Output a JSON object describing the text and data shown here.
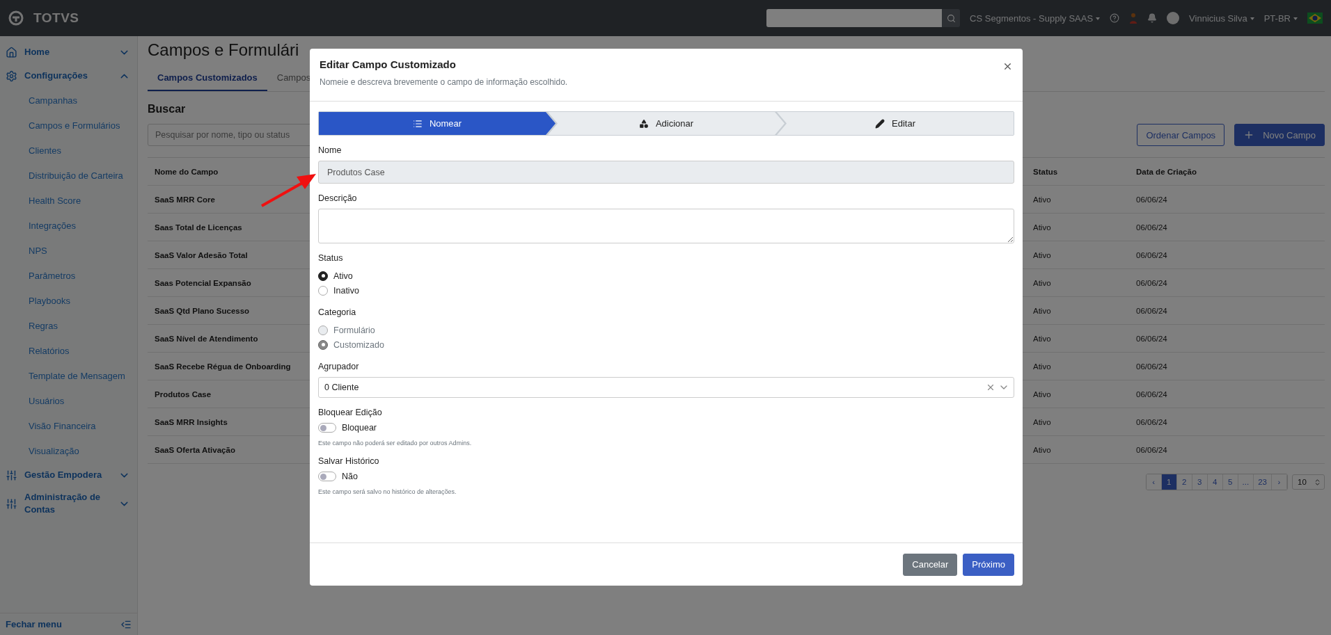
{
  "topbar": {
    "logo": "TOTVS",
    "workspace": "CS Segmentos - Supply SAAS",
    "user": "Vinnicius Silva",
    "language": "PT-BR"
  },
  "sidebar": {
    "items": [
      {
        "label": "Home",
        "kind": "home",
        "expanded": false
      },
      {
        "label": "Configurações",
        "kind": "gear",
        "expanded": true,
        "children": [
          {
            "label": "Campanhas"
          },
          {
            "label": "Campos e Formulários"
          },
          {
            "label": "Clientes"
          },
          {
            "label": "Distribuição de Carteira"
          },
          {
            "label": "Health Score"
          },
          {
            "label": "Integrações"
          },
          {
            "label": "NPS"
          },
          {
            "label": "Parâmetros"
          },
          {
            "label": "Playbooks"
          },
          {
            "label": "Regras"
          },
          {
            "label": "Relatórios"
          },
          {
            "label": "Template de Mensagem"
          },
          {
            "label": "Usuários"
          },
          {
            "label": "Visão Financeira"
          },
          {
            "label": "Visualização"
          }
        ]
      },
      {
        "label": "Gestão Empodera",
        "kind": "sliders",
        "expanded": false
      },
      {
        "label": "Administração de Contas",
        "kind": "sliders",
        "expanded": false
      }
    ],
    "footer": "Fechar menu"
  },
  "page": {
    "title": "Campos e Formulári",
    "tabs": [
      {
        "label": "Campos Customizados",
        "selected": true
      },
      {
        "label": "Campos",
        "selected": false
      }
    ],
    "search_heading": "Buscar",
    "search": {
      "placeholder": "Pesquisar por nome, tipo ou status"
    },
    "buttons": [
      {
        "label": "Ordenar Campos",
        "kind": "outline"
      },
      {
        "label": "Novo Campo",
        "kind": "primary"
      }
    ],
    "table": {
      "columns": [
        "Nome do Campo",
        "Status",
        "Data de Criação"
      ],
      "rows": [
        {
          "name": "SaaS MRR Core",
          "status": "Ativo",
          "created": "06/06/24"
        },
        {
          "name": "Saas Total de Licenças",
          "status": "Ativo",
          "created": "06/06/24"
        },
        {
          "name": "SaaS Valor Adesão Total",
          "status": "Ativo",
          "created": "06/06/24"
        },
        {
          "name": "Saas Potencial Expansão",
          "status": "Ativo",
          "created": "06/06/24"
        },
        {
          "name": "SaaS Qtd Plano Sucesso",
          "status": "Ativo",
          "created": "06/06/24"
        },
        {
          "name": "SaaS Nível de Atendimento",
          "status": "Ativo",
          "created": "06/06/24"
        },
        {
          "name": "SaaS Recebe Régua de Onboarding",
          "status": "Ativo",
          "created": "06/06/24"
        },
        {
          "name": "Produtos Case",
          "status": "Ativo",
          "created": "06/06/24"
        },
        {
          "name": "SaaS MRR Insights",
          "status": "Ativo",
          "created": "06/06/24"
        },
        {
          "name": "SaaS Oferta Ativação",
          "status": "Ativo",
          "created": "06/06/24"
        }
      ]
    },
    "pagination": {
      "prev": "‹",
      "next": "›",
      "pages": [
        {
          "label": "1",
          "selected": true
        },
        {
          "label": "2",
          "selected": false
        },
        {
          "label": "3",
          "selected": false
        },
        {
          "label": "4",
          "selected": false
        },
        {
          "label": "5",
          "selected": false
        },
        {
          "label": "...",
          "selected": false
        },
        {
          "label": "23",
          "selected": false
        }
      ],
      "page_size": "10"
    }
  },
  "modal": {
    "title": "Editar Campo Customizado",
    "subtitle": "Nomeie e descreva brevemente o campo de informação escolhido.",
    "steps": [
      {
        "label": "Nomear",
        "kind": "list",
        "selected": true
      },
      {
        "label": "Adicionar",
        "kind": "shapes",
        "selected": false
      },
      {
        "label": "Editar",
        "kind": "pencil",
        "selected": false
      }
    ],
    "fields": [
      {
        "kind": "text",
        "label": "Nome",
        "value": "Produtos Case",
        "disabled": true
      },
      {
        "kind": "textarea",
        "label": "Descrição"
      },
      {
        "kind": "radio",
        "label": "Status",
        "options": [
          {
            "label": "Ativo",
            "selected": true,
            "disabled": false
          },
          {
            "label": "Inativo",
            "selected": false,
            "disabled": false
          }
        ]
      },
      {
        "kind": "radio",
        "label": "Categoria",
        "options": [
          {
            "label": "Formulário",
            "selected": false,
            "disabled": true
          },
          {
            "label": "Customizado",
            "selected": true,
            "disabled": true
          }
        ]
      },
      {
        "kind": "select",
        "label": "Agrupador",
        "value": "0 Cliente"
      },
      {
        "kind": "toggle",
        "label": "Bloquear Edição",
        "option": "Bloquear",
        "on": false,
        "help": "Este campo não poderá ser editado por outros Admins."
      },
      {
        "kind": "toggle",
        "label": "Salvar Histórico",
        "option": "Não",
        "on": false,
        "help": "Este campo será salvo no histórico de alterações."
      }
    ],
    "buttons": [
      {
        "label": "Cancelar",
        "kind": "secondary"
      },
      {
        "label": "Próximo",
        "kind": "primary"
      }
    ]
  }
}
